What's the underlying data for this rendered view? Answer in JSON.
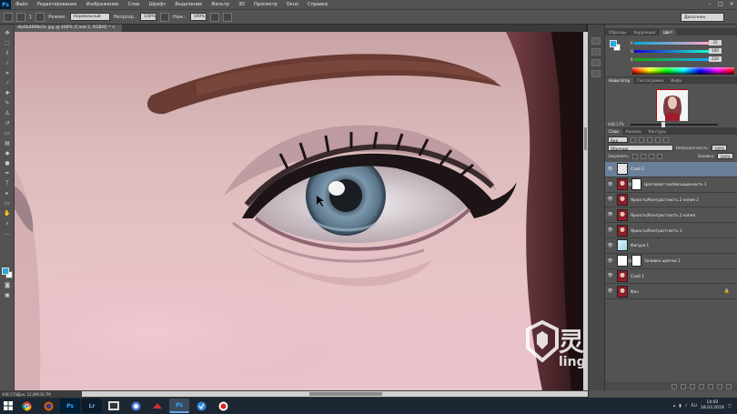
{
  "app": {
    "logo": "Ps",
    "menu": [
      "Файл",
      "Редактирование",
      "Изображение",
      "Слои",
      "Шрифт",
      "Выделение",
      "Фильтр",
      "3D",
      "Просмотр",
      "Окно",
      "Справка"
    ],
    "window_controls": [
      "–",
      "□",
      "✕"
    ]
  },
  "options": {
    "brush_size": "1",
    "mode_label": "Режим:",
    "mode_value": "Нормальный",
    "opacity_label": "Непрозр.:",
    "opacity_value": "100%",
    "flow_label": "Наж.:",
    "flow_value": "100%",
    "workspace": "Дополнен."
  },
  "document": {
    "tab_title": "dip6b4698e3c.jpg @ 448% (Слой 2, RGB/8) *",
    "tab_close": "×"
  },
  "status": {
    "zoom": "448,17%",
    "doc_size": "Док: 12,8М/30,7М"
  },
  "panels": {
    "color_tabs": [
      "Образцы",
      "Коррекция",
      "Цвет"
    ],
    "color_active": "Цвет",
    "color_values": {
      "r": "22",
      "g": "169",
      "b": "210"
    },
    "color_labels": {
      "r": "R",
      "g": "G",
      "b": "B"
    },
    "navigator_tabs": [
      "Навигатор",
      "Гистограмма",
      "Инфо"
    ],
    "navigator_zoom": "448,17%",
    "layer_tabs": [
      "Слои",
      "Каналы",
      "Контуры"
    ],
    "layer_filter": "Вид",
    "blend_mode": "Обычные",
    "opacity_label": "Непрозрачность:",
    "opacity_value": "100%",
    "lock_label": "Закрепить:",
    "fill_label": "Заливка:",
    "fill_value": "100%",
    "layers": [
      {
        "name": "Слой 2",
        "selected": true,
        "thumb": "checker",
        "mask": false
      },
      {
        "name": "Цветовой тон/Насыщенность 1",
        "selected": false,
        "thumb": "portrait",
        "mask": true
      },
      {
        "name": "Яркость/Контрастность 2 копия 2",
        "selected": false,
        "thumb": "portrait",
        "mask": false
      },
      {
        "name": "Яркость/Контрастность 2 копия",
        "selected": false,
        "thumb": "portrait",
        "mask": false
      },
      {
        "name": "Яркость/Контрастность 1",
        "selected": false,
        "thumb": "portrait",
        "mask": false
      },
      {
        "name": "Фигура 1",
        "selected": false,
        "thumb": "light",
        "mask": false
      },
      {
        "name": "Заливка цветом 1",
        "selected": false,
        "thumb": "white",
        "mask": true
      },
      {
        "name": "Слой 1",
        "selected": false,
        "thumb": "portrait",
        "mask": false
      },
      {
        "name": "Фон",
        "selected": false,
        "thumb": "portrait",
        "mask": false,
        "locked": true
      }
    ],
    "layers_footer_icons": [
      "link-icon",
      "fx-icon",
      "mask-icon",
      "adjustment-icon",
      "folder-icon",
      "new-layer-icon",
      "trash-icon"
    ]
  },
  "taskbar": {
    "apps": [
      "Chrome",
      "Firefox",
      "Ps",
      "Lr",
      "Media",
      "Chat",
      "Tool",
      "Ps",
      "App",
      "Rec"
    ],
    "lang": "RU",
    "time": "14:02",
    "date": "18.03.2019"
  },
  "watermark": {
    "cn": "灵感中国",
    "en": "lingganchina.com"
  },
  "colors": {
    "foreground": "#2aa7df",
    "background": "#ffffff",
    "selected_layer": "#6a7f9a"
  }
}
